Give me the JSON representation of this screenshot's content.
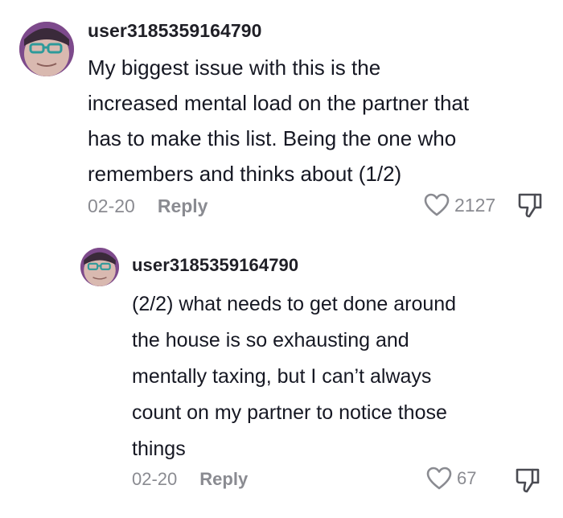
{
  "comments": [
    {
      "username": "user3185359164790",
      "lines": [
        "My biggest issue with this is the",
        "increased mental load on the partner that",
        "has to make this list. Being the one who",
        "remembers and thinks about (1/2)"
      ],
      "date": "02-20",
      "reply_label": "Reply",
      "likes": "2127",
      "avatar_icon": "user-avatar",
      "like_icon": "heart-outline-icon",
      "dislike_icon": "thumbs-down-icon"
    },
    {
      "username": "user3185359164790",
      "lines": [
        "(2/2) what needs to get done around",
        "the house is so exhausting and",
        "mentally taxing, but I can’t always",
        "count on my partner to notice those",
        "things"
      ],
      "date": "02-20",
      "reply_label": "Reply",
      "likes": "67",
      "avatar_icon": "user-avatar",
      "like_icon": "heart-outline-icon",
      "dislike_icon": "thumbs-down-icon"
    }
  ],
  "colors": {
    "text": "#161823",
    "muted": "#8a8b91",
    "background": "#ffffff"
  }
}
